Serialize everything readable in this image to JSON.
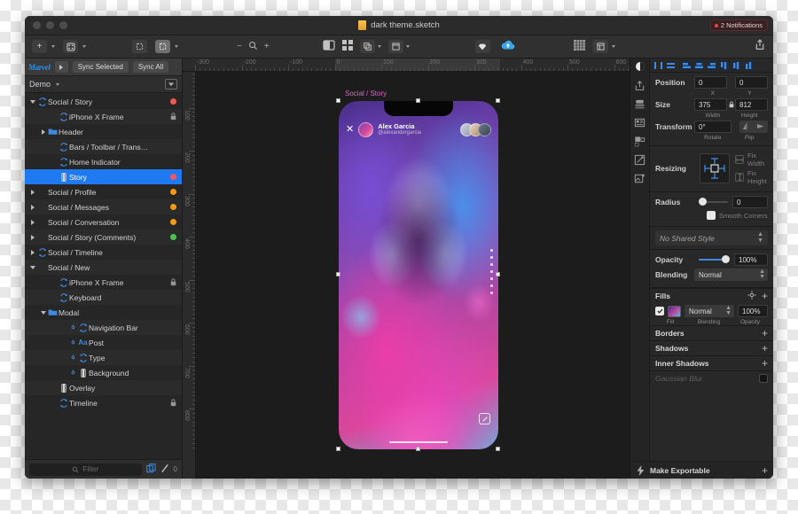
{
  "window": {
    "title": "dark theme.sketch",
    "doc_icon": "sketch-document-icon",
    "traffic_lights": [
      "close",
      "minimize",
      "zoom"
    ],
    "notifications": {
      "label": "2 Notifications",
      "count": 2,
      "dot_color": "#e8493a"
    }
  },
  "toolbar": {
    "insert_label": "insert-icon",
    "symbols_label": "symbols-icon",
    "rotate_label": "rotate-copies-icon",
    "scale_label": "scale-icon",
    "zoom_out": "−",
    "zoom_icon": "magnifier-icon",
    "zoom_in": "+",
    "mask_icon": "mask-icon",
    "grid_icon": "grid-view-icon",
    "group_icon": "group-icon",
    "artboard_icon": "artboard-icon",
    "diamond_icon": "sketch-cloud-upload-icon",
    "cloud_icon": "cloud-icon",
    "pixel_grid_icon": "pixel-grid-icon",
    "view_icon": "view-options-icon",
    "share_icon": "share-icon"
  },
  "marvel_plugin": {
    "logo": "Marvel",
    "play_label": "play-icon",
    "sync_selected": "Sync Selected",
    "sync_all": "Sync All"
  },
  "sidebar": {
    "page_name": "Demo",
    "page_chevron": "chevron-down-icon",
    "panel_toggle_icon": "panel-toggle-icon",
    "filter_placeholder": "Filter",
    "filter_value": "",
    "search_icon": "search-icon",
    "duplicate_icon": "duplicate-icon",
    "pen_icon": "pen-icon",
    "count": "0",
    "layers": [
      {
        "label": "Social / Story",
        "indent": 0,
        "icon": "symbol-icon",
        "disclosure": "down",
        "status_color": "#f2584f",
        "locked": false,
        "selected": false
      },
      {
        "label": "iPhone X Frame",
        "indent": 2,
        "icon": "symbol-icon",
        "disclosure": "none",
        "status_color": "",
        "locked": true,
        "selected": false
      },
      {
        "label": "Header",
        "indent": 1,
        "icon": "folder-icon",
        "disclosure": "right",
        "status_color": "",
        "locked": false,
        "selected": false
      },
      {
        "label": "Bars / Toolbar / Trans…",
        "indent": 2,
        "icon": "symbol-icon",
        "disclosure": "none",
        "status_color": "",
        "locked": false,
        "selected": false
      },
      {
        "label": "Home Indicator",
        "indent": 2,
        "icon": "symbol-icon",
        "disclosure": "none",
        "status_color": "",
        "locked": false,
        "selected": false
      },
      {
        "label": "Story",
        "indent": 2,
        "icon": "shape-icon",
        "disclosure": "none",
        "status_color": "#f4576a",
        "locked": false,
        "selected": true
      },
      {
        "label": "Social / Profile",
        "indent": 0,
        "icon": "none",
        "disclosure": "right",
        "status_color": "#f49a1a",
        "locked": false,
        "selected": false
      },
      {
        "label": "Social / Messages",
        "indent": 0,
        "icon": "none",
        "disclosure": "right",
        "status_color": "#f49a1a",
        "locked": false,
        "selected": false
      },
      {
        "label": "Social / Conversation",
        "indent": 0,
        "icon": "none",
        "disclosure": "right",
        "status_color": "#f49a1a",
        "locked": false,
        "selected": false
      },
      {
        "label": "Social / Story (Comments)",
        "indent": 0,
        "icon": "none",
        "disclosure": "right",
        "status_color": "#4cc44c",
        "locked": false,
        "selected": false
      },
      {
        "label": "Social / Timeline",
        "indent": 0,
        "icon": "symbol-icon",
        "disclosure": "right",
        "status_color": "",
        "locked": false,
        "selected": false
      },
      {
        "label": "Social / New",
        "indent": 0,
        "icon": "none",
        "disclosure": "down",
        "status_color": "",
        "locked": false,
        "selected": false
      },
      {
        "label": "iPhone X Frame",
        "indent": 2,
        "icon": "symbol-icon",
        "disclosure": "none",
        "status_color": "",
        "locked": true,
        "selected": false
      },
      {
        "label": "Keyboard",
        "indent": 2,
        "icon": "symbol-icon",
        "disclosure": "none",
        "status_color": "",
        "locked": false,
        "selected": false
      },
      {
        "label": "Modal",
        "indent": 1,
        "icon": "folder-icon",
        "disclosure": "down",
        "status_color": "",
        "locked": false,
        "selected": false
      },
      {
        "label": "Navigation Bar",
        "indent": 3,
        "icon": "symbol-icon",
        "disclosure": "none",
        "status_color": "",
        "locked": false,
        "selected": false
      },
      {
        "label": "Post",
        "indent": 3,
        "icon": "text-icon",
        "disclosure": "none",
        "status_color": "",
        "locked": false,
        "selected": false
      },
      {
        "label": "Type",
        "indent": 3,
        "icon": "symbol-icon",
        "disclosure": "none",
        "status_color": "",
        "locked": false,
        "selected": false
      },
      {
        "label": "Background",
        "indent": 3,
        "icon": "shape-icon",
        "disclosure": "none",
        "status_color": "",
        "locked": false,
        "selected": false
      },
      {
        "label": "Overlay",
        "indent": 2,
        "icon": "shape-icon",
        "disclosure": "none",
        "status_color": "",
        "locked": false,
        "selected": false
      },
      {
        "label": "Timeline",
        "indent": 2,
        "icon": "symbol-icon",
        "disclosure": "none",
        "status_color": "",
        "locked": true,
        "selected": false
      }
    ]
  },
  "canvas": {
    "artboard_label": "Social / Story",
    "artboard_label_color": "#e361c9",
    "ruler_h_ticks": [
      "-300",
      "-200",
      "-100",
      "0",
      "100",
      "200",
      "300",
      "400",
      "500",
      "600"
    ],
    "ruler_v_ticks": [
      "0",
      "100",
      "200",
      "300",
      "400",
      "500",
      "600",
      "700",
      "800"
    ],
    "story": {
      "close_icon": "close-icon",
      "user_name": "Alex Garcia",
      "user_handle": "@alexandergarcia",
      "avatar_icon": "avatar",
      "viewer_avatars": [
        "viewer-avatar-1",
        "viewer-avatar-2",
        "viewer-avatar-3"
      ],
      "compose_icon": "compose-icon",
      "home_indicator": "home-indicator"
    }
  },
  "inspector": {
    "rail_icons": [
      "theme-contrast-icon",
      "export-icon",
      "layers-stack-icon",
      "list-view-icon",
      "components-icon",
      "edit-icon",
      "add-image-icon"
    ],
    "align_icons": [
      "distribute-horizontal-icon",
      "distribute-vertical-icon",
      "align-left-icon",
      "align-center-icon",
      "align-right-icon",
      "align-top-icon",
      "align-middle-icon",
      "align-bottom-icon"
    ],
    "position": {
      "label": "Position",
      "x": "0",
      "y": "0",
      "x_unit": "X",
      "y_unit": "Y"
    },
    "size": {
      "label": "Size",
      "width": "375",
      "height": "812",
      "width_unit": "Width",
      "height_unit": "Height",
      "lock_icon": "lock-proportions-icon"
    },
    "transform": {
      "label": "Transform",
      "rotate": "0°",
      "rotate_unit": "Rotate",
      "flip_unit": "Flip",
      "flip_h_icon": "flip-horizontal-icon",
      "flip_v_icon": "flip-vertical-icon"
    },
    "resizing": {
      "label": "Resizing",
      "fix_width": "Fix Width",
      "fix_height": "Fix Height",
      "pin_icon": "resize-pin-icon"
    },
    "radius": {
      "label": "Radius",
      "value": "0",
      "smooth_corners": "Smooth Corners",
      "smooth_checked": true
    },
    "shared_style": {
      "value": "No Shared Style",
      "stepper_icon": "stepper-icon"
    },
    "opacity": {
      "label": "Opacity",
      "value": "100%",
      "slider_pct": 78
    },
    "blending": {
      "label": "Blending",
      "value": "Normal"
    },
    "fills": {
      "title": "Fills",
      "gear_icon": "gear-icon",
      "add_icon": "plus-icon",
      "checked": true,
      "swatch_icon": "fill-swatch",
      "blending_value": "Normal",
      "opacity_value": "100%",
      "col_fill": "Fill",
      "col_blending": "Blending",
      "col_opacity": "Opacity"
    },
    "borders": {
      "title": "Borders",
      "add_icon": "plus-icon"
    },
    "shadows": {
      "title": "Shadows",
      "add_icon": "plus-icon"
    },
    "inner_shadows": {
      "title": "Inner Shadows",
      "add_icon": "plus-icon"
    },
    "blur": {
      "title": "Gaussian Blur",
      "stepper_icon": "stepper-icon",
      "enabled": false
    },
    "make_exportable": {
      "label": "Make Exportable",
      "bolt_icon": "bolt-icon",
      "add_icon": "plus-icon"
    }
  }
}
